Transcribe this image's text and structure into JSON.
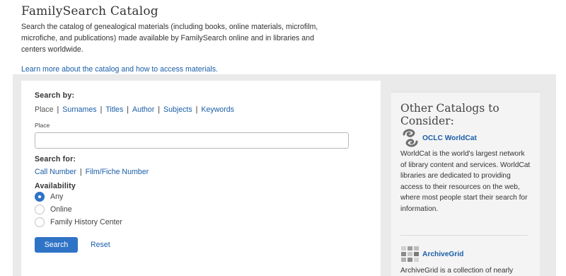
{
  "header": {
    "title": "FamilySearch Catalog",
    "intro": "Search the catalog of genealogical materials (including books, online materials, microfilm, microfiche, and publications) made available by FamilySearch online and in libraries and centers worldwide.",
    "learn_link": "Learn more about the catalog and how to access materials."
  },
  "search_form": {
    "search_by_label": "Search by:",
    "tabs": [
      "Place",
      "Surnames",
      "Titles",
      "Author",
      "Subjects",
      "Keywords"
    ],
    "active_tab": "Place",
    "place_label": "Place",
    "place_value": "",
    "search_for_label": "Search for:",
    "search_for_links": [
      "Call Number",
      "Film/Fiche Number"
    ],
    "availability_label": "Availability",
    "availability_options": [
      "Any",
      "Online",
      "Family History Center"
    ],
    "availability_selected": "Any",
    "search_button": "Search",
    "reset_link": "Reset"
  },
  "sidebar": {
    "title": "Other Catalogs to Consider:",
    "catalogs": [
      {
        "name": "OCLC WorldCat",
        "icon": "worldcat-logo-icon",
        "description": "WorldCat is the world's largest network of library content and services. WorldCat libraries are dedicated to providing access to their resources on the web, where most people start their search for information."
      },
      {
        "name": "ArchiveGrid",
        "icon": "archivegrid-logo-icon",
        "description": "ArchiveGrid is a collection of nearly"
      }
    ]
  },
  "colors": {
    "link": "#1a5ea8",
    "primary_button": "#2f73c7",
    "panel_background": "#eaeaea",
    "sidebar_background": "#f4f4f4"
  }
}
